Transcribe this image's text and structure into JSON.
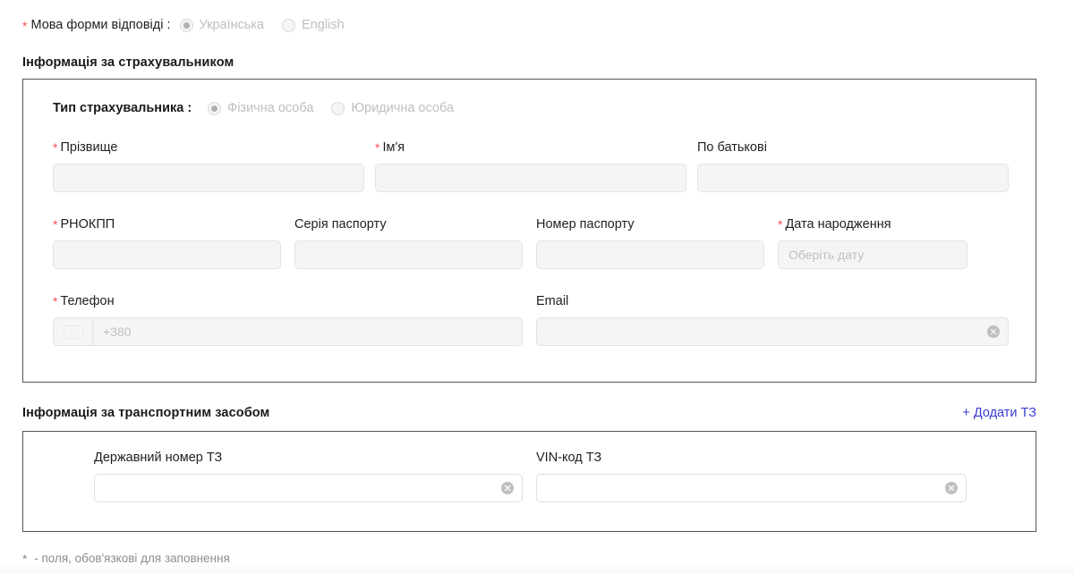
{
  "language_row": {
    "required_marker": "*",
    "label": "Мова форми відповіді :",
    "options": [
      {
        "label": "Українська",
        "selected": true,
        "disabled": true
      },
      {
        "label": "English",
        "selected": false,
        "disabled": true
      }
    ]
  },
  "insurer_section": {
    "title": "Інформація за страхувальником",
    "type_row": {
      "label": "Тип страхувальника :",
      "options": [
        {
          "label": "Фізична особа",
          "selected": true,
          "disabled": true
        },
        {
          "label": "Юридична особа",
          "selected": false,
          "disabled": true
        }
      ]
    },
    "fields": {
      "last_name": {
        "label": "Прізвище",
        "required_marker": "*",
        "value": "",
        "placeholder": ""
      },
      "first_name": {
        "label": "Ім'я",
        "required_marker": "*",
        "value": "",
        "placeholder": ""
      },
      "patronymic": {
        "label": "По батькові",
        "required_marker": "",
        "value": "",
        "placeholder": ""
      },
      "rnokpp": {
        "label": "РНОКПП",
        "required_marker": "*",
        "value": "",
        "placeholder": ""
      },
      "passport_series": {
        "label": "Серія паспорту",
        "required_marker": "",
        "value": "",
        "placeholder": ""
      },
      "passport_number": {
        "label": "Номер паспорту",
        "required_marker": "",
        "value": "",
        "placeholder": ""
      },
      "birth_date": {
        "label": "Дата народження",
        "required_marker": "*",
        "value": "",
        "placeholder": "Оберіть дату"
      },
      "phone": {
        "label": "Телефон",
        "required_marker": "*",
        "value": "",
        "placeholder": "+380",
        "country_flag": "ua-flag-icon"
      },
      "email": {
        "label": "Email",
        "required_marker": "",
        "value": "",
        "placeholder": "",
        "clear_icon": "clear-circle-icon"
      }
    }
  },
  "vehicle_section": {
    "title": "Інформація за транспортним засобом",
    "add_link": "+ Додати ТЗ",
    "fields": {
      "plate_number": {
        "label": "Державний номер ТЗ",
        "required_marker": "",
        "value": "",
        "placeholder": "",
        "clear_icon": "clear-circle-icon"
      },
      "vin_code": {
        "label": "VIN-код ТЗ",
        "required_marker": "",
        "value": "",
        "placeholder": "",
        "clear_icon": "clear-circle-icon"
      }
    }
  },
  "footer": {
    "star": "*",
    "note": " - поля, обов'язкові для заповнення"
  },
  "colors": {
    "required_star": "#ff4d4f",
    "link": "#3b3bd6",
    "panel_border": "#555555",
    "input_bg": "#f5f5f5",
    "placeholder": "#bfbfbf",
    "muted_text": "#8c8c8c"
  }
}
